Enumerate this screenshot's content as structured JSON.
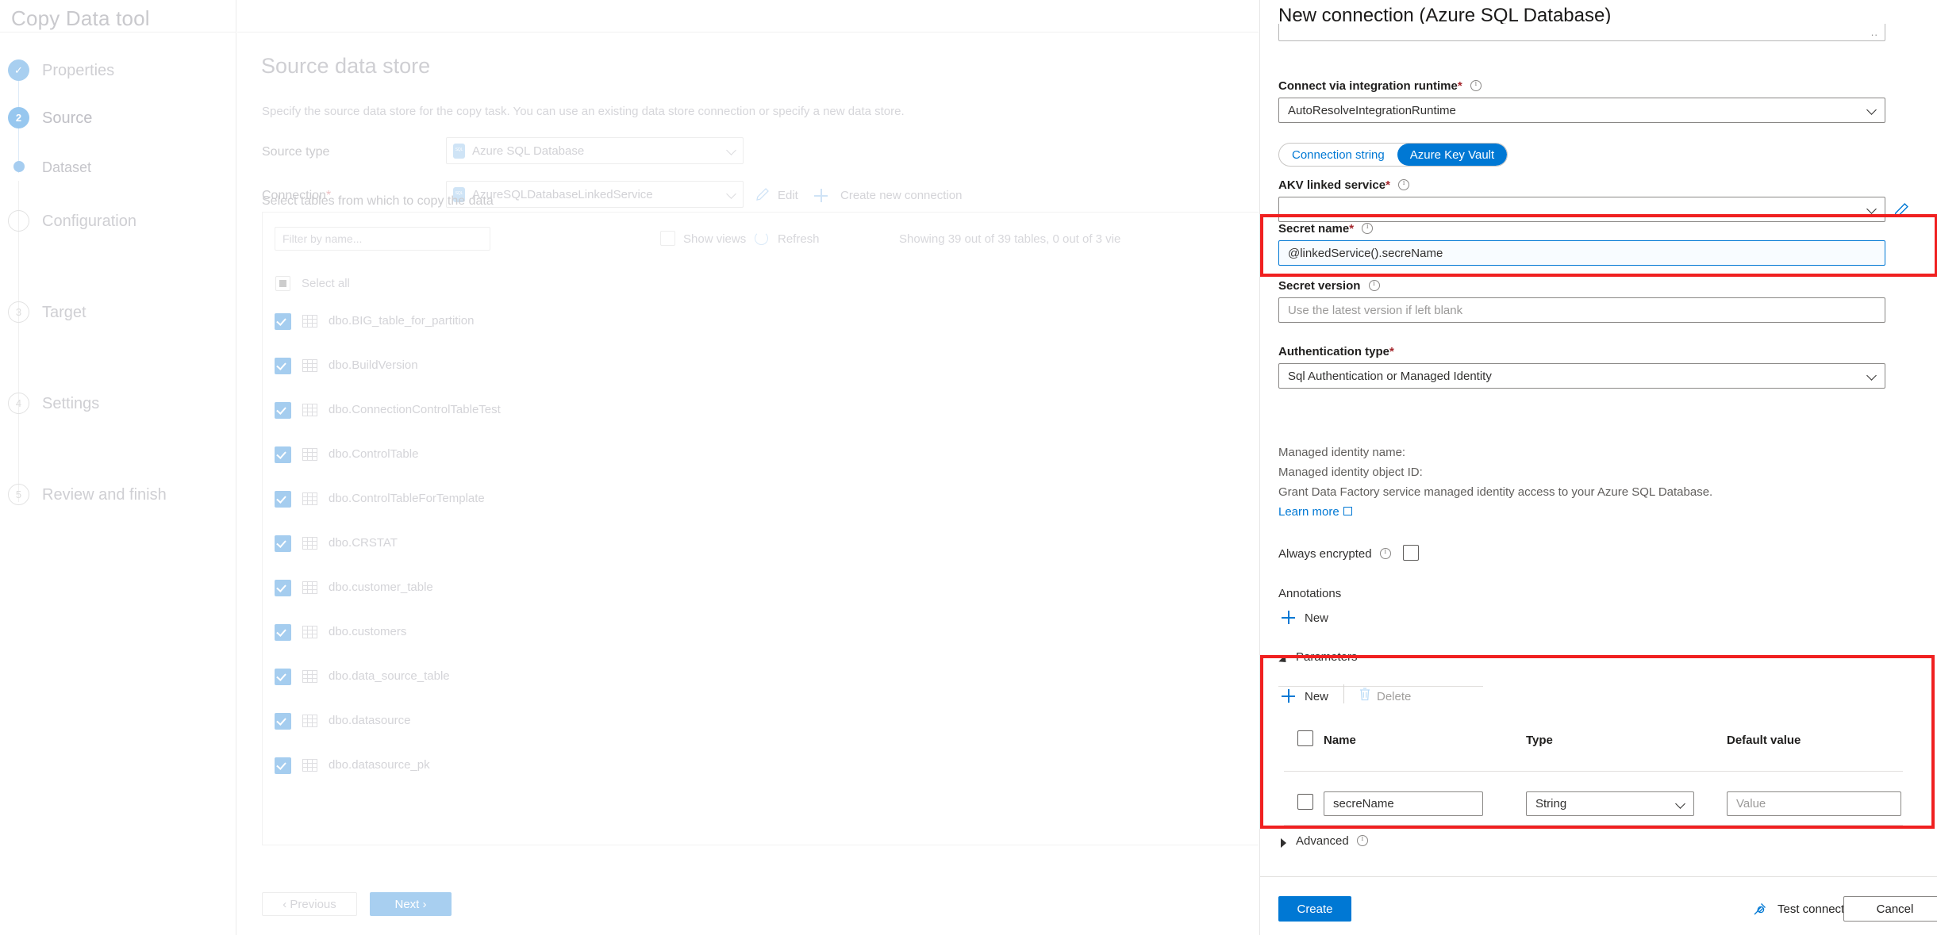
{
  "app": {
    "title": "Copy Data tool"
  },
  "wizard": {
    "steps": [
      {
        "marker": "✓",
        "label": "Properties",
        "state": "done"
      },
      {
        "marker": "2",
        "label": "Source",
        "state": "active"
      },
      {
        "marker": "",
        "label": "Dataset",
        "state": "substep"
      },
      {
        "marker": "",
        "label": "Configuration",
        "state": "todo"
      },
      {
        "marker": "3",
        "label": "Target",
        "state": "todo"
      },
      {
        "marker": "4",
        "label": "Settings",
        "state": "todo"
      },
      {
        "marker": "5",
        "label": "Review and finish",
        "state": "todo"
      }
    ]
  },
  "main": {
    "heading": "Source data store",
    "subtitle": "Specify the source data store for the copy task. You can use an existing data store connection or specify a new data store.",
    "source_type_label": "Source type",
    "source_type_value": "Azure SQL Database",
    "connection_label": "Connection",
    "connection_required": "*",
    "connection_value": "AzureSQLDatabaseLinkedService",
    "edit_label": "Edit",
    "create_new_connection_label": "Create new connection",
    "tables_caption": "Select tables from which to copy the data",
    "filter_placeholder": "Filter by name...",
    "show_views_label": "Show views",
    "refresh_label": "Refresh",
    "showing_text": "Showing 39 out of 39 tables, 0 out of 3 vie",
    "select_all_label": "Select all",
    "tables": [
      "dbo.BIG_table_for_partition",
      "dbo.BuildVersion",
      "dbo.ConnectionControlTableTest",
      "dbo.ControlTable",
      "dbo.ControlTableForTemplate",
      "dbo.CRSTAT",
      "dbo.customer_table",
      "dbo.customers",
      "dbo.data_source_table",
      "dbo.datasource",
      "dbo.datasource_pk"
    ],
    "previous_label": "‹  Previous",
    "next_label": "Next  ›"
  },
  "panel": {
    "title": "New connection (Azure SQL Database)",
    "scrolled_field_dots": "..",
    "integration_runtime_label": "Connect via integration runtime",
    "integration_runtime_required": "*",
    "integration_runtime_value": "AutoResolveIntegrationRuntime",
    "toggle": {
      "connection_string": "Connection string",
      "azure_key_vault": "Azure Key Vault",
      "selected": "Azure Key Vault"
    },
    "akv_label": "AKV linked service",
    "akv_required": "*",
    "akv_value": "",
    "secret_name_label": "Secret name",
    "secret_name_required": "*",
    "secret_name_value": "@linkedService().secreName",
    "secret_version_label": "Secret version",
    "secret_version_placeholder": "Use the latest version if left blank",
    "auth_type_label": "Authentication type",
    "auth_type_required": "*",
    "auth_type_value": "Sql Authentication or Managed Identity",
    "managed_identity_name": "Managed identity name:",
    "managed_identity_object_id": "Managed identity object ID:",
    "grant_text": "Grant Data Factory service managed identity access to your Azure SQL Database.",
    "learn_more": "Learn more",
    "always_encrypted_label": "Always encrypted",
    "annotations_label": "Annotations",
    "annotations_new_label": "New",
    "parameters_label": "Parameters",
    "parameters_new_label": "New",
    "parameters_delete_label": "Delete",
    "param_columns": {
      "name": "Name",
      "type": "Type",
      "default_value": "Default value"
    },
    "parameters": [
      {
        "name": "secreName",
        "type": "String",
        "default_value_placeholder": "Value"
      }
    ],
    "advanced_label": "Advanced",
    "create_label": "Create",
    "test_connection_label": "Test connection",
    "cancel_label": "Cancel"
  },
  "colors": {
    "accent": "#0078d4",
    "highlight_box": "#f02020",
    "required_star": "#a4262c",
    "dim_checkbox": "#a5cdef",
    "next_button": "#a8cff0"
  }
}
